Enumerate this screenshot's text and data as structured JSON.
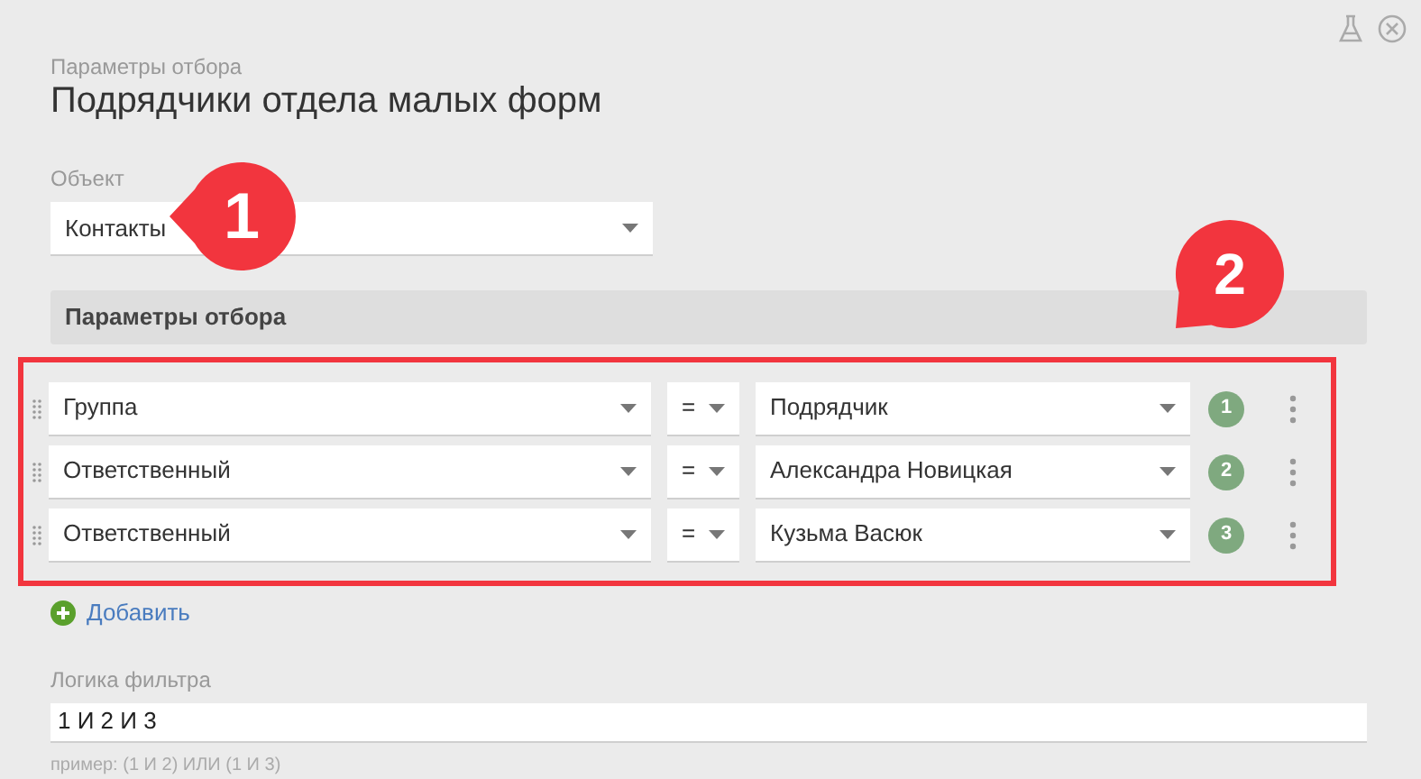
{
  "header": {
    "subtitle": "Параметры отбора",
    "title": "Подрядчики отдела малых форм"
  },
  "object": {
    "label": "Объект",
    "value": "Контакты"
  },
  "section": {
    "title": "Параметры отбора"
  },
  "conditions": [
    {
      "field": "Группа",
      "operator": "=",
      "value": "Подрядчик",
      "number": "1"
    },
    {
      "field": "Ответственный",
      "operator": "=",
      "value": "Александра Новицкая",
      "number": "2"
    },
    {
      "field": "Ответственный",
      "operator": "=",
      "value": "Кузьма Васюк",
      "number": "3"
    }
  ],
  "add_link": "Добавить",
  "logic": {
    "label": "Логика фильтра",
    "value": "1 И 2 И 3",
    "hint": "пример: (1 И 2) ИЛИ (1 И 3)"
  },
  "callouts": [
    {
      "text": "1"
    },
    {
      "text": "2"
    }
  ]
}
